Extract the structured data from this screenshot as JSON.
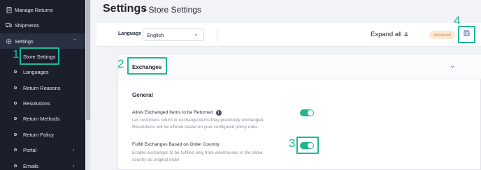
{
  "sidebar": {
    "items": [
      {
        "label": "Manage Returns",
        "icon": "document-icon"
      },
      {
        "label": "Shipments",
        "icon": "truck-icon"
      },
      {
        "label": "Settings",
        "icon": "gear-icon"
      }
    ],
    "subitems": [
      {
        "label": "Store Settings"
      },
      {
        "label": "Languages"
      },
      {
        "label": "Return Reasons"
      },
      {
        "label": "Resolutions"
      },
      {
        "label": "Return Methods"
      },
      {
        "label": "Return Policy"
      },
      {
        "label": "Portal"
      },
      {
        "label": "Emails"
      }
    ]
  },
  "annotations": {
    "n1": "1",
    "n2": "2",
    "n3": "3",
    "n4": "4"
  },
  "header": {
    "title": "Settings",
    "separator": "•",
    "subtitle": "Store Settings"
  },
  "toolbar": {
    "language_label": "Language",
    "language_value": "English",
    "expand_all_label": "Expand all",
    "status_badge": "unsaved"
  },
  "panel": {
    "title": "Exchanges",
    "section_title": "General",
    "settings": [
      {
        "label": "Allow Exchanged Items to be Returned",
        "description_line1": "Let customers return or exchange items they previously exchanged.",
        "description_line2": "Resolutions will be offered based on your configured policy rules.",
        "enabled": true
      },
      {
        "label": "Fulfill Exchanges Based on Order Country",
        "description_line1": "Enable exchanges to be fulfilled only from warehouses in the same",
        "description_line2": "country as original order",
        "enabled": true
      }
    ]
  },
  "colors": {
    "accent": "#1db89a",
    "toggle_on": "#22b58d",
    "sidebar_bg": "#1b1f2b",
    "link_blue": "#3a66c4"
  }
}
